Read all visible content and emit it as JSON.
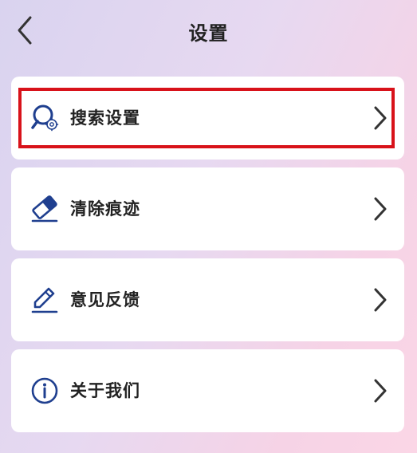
{
  "header": {
    "title": "设置",
    "back_icon": "back-arrow-icon"
  },
  "menu": {
    "items": [
      {
        "label": "搜索设置",
        "icon": "search-settings-icon"
      },
      {
        "label": "清除痕迹",
        "icon": "eraser-icon"
      },
      {
        "label": "意见反馈",
        "icon": "pencil-icon"
      },
      {
        "label": "关于我们",
        "icon": "info-icon"
      }
    ],
    "chevron_icon": "chevron-right-icon"
  },
  "colors": {
    "icon_blue": "#1f3f8f",
    "highlight_red": "#d8121a",
    "text": "#222222"
  }
}
